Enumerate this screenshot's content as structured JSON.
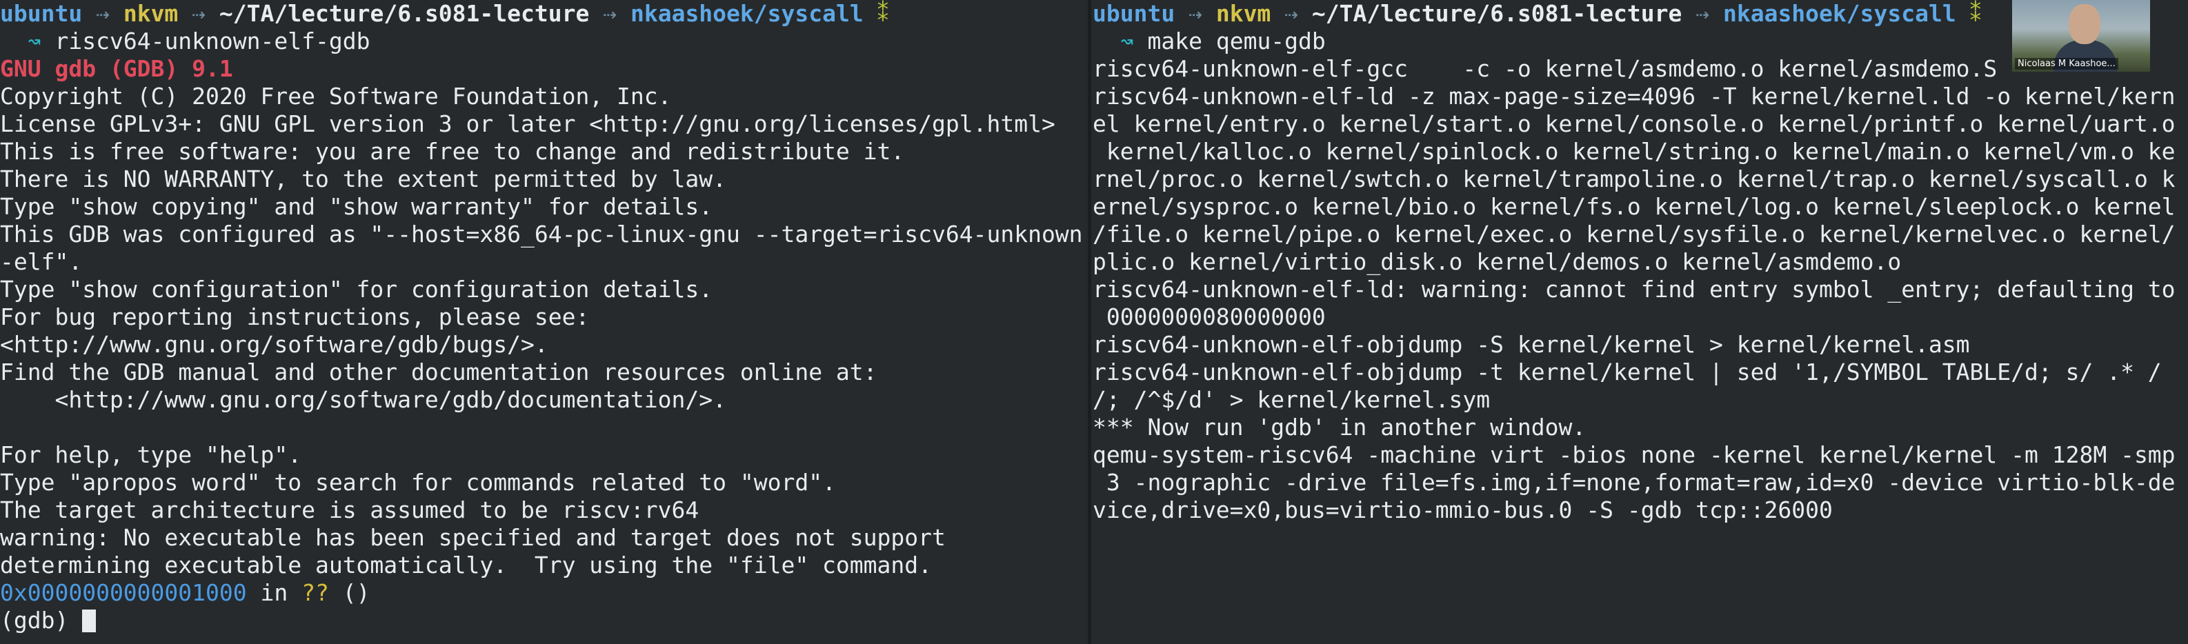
{
  "left_pane": {
    "prompt": {
      "user": "ubuntu",
      "host": "nkvm",
      "path": "~/TA/lecture/6.s081-lecture",
      "branch": "nkaashoek/syscall",
      "git_icon": "⁑",
      "symbol": "↝",
      "command": "riscv64-unknown-elf-gdb"
    },
    "version": "GNU gdb (GDB) 9.1",
    "lines": [
      "Copyright (C) 2020 Free Software Foundation, Inc.",
      "License GPLv3+: GNU GPL version 3 or later <http://gnu.org/licenses/gpl.html>",
      "This is free software: you are free to change and redistribute it.",
      "There is NO WARRANTY, to the extent permitted by law.",
      "Type \"show copying\" and \"show warranty\" for details.",
      "This GDB was configured as \"--host=x86_64-pc-linux-gnu --target=riscv64-unknown",
      "-elf\".",
      "Type \"show configuration\" for configuration details.",
      "For bug reporting instructions, please see:",
      "<http://www.gnu.org/software/gdb/bugs/>.",
      "Find the GDB manual and other documentation resources online at:",
      "    <http://www.gnu.org/software/gdb/documentation/>.",
      "",
      "For help, type \"help\".",
      "Type \"apropos word\" to search for commands related to \"word\".",
      "The target architecture is assumed to be riscv:rv64",
      "warning: No executable has been specified and target does not support",
      "determining executable automatically.  Try using the \"file\" command."
    ],
    "location": {
      "address": "0x0000000000001000",
      "in": "in",
      "func": "??",
      "args": "()"
    },
    "gdb_prompt": "(gdb)"
  },
  "right_pane": {
    "prompt": {
      "user": "ubuntu",
      "host": "nkvm",
      "path": "~/TA/lecture/6.s081-lecture",
      "branch": "nkaashoek/syscall",
      "git_icon": "⁑",
      "symbol": "↝",
      "command": "make qemu-gdb"
    },
    "lines": [
      "riscv64-unknown-elf-gcc    -c -o kernel/asmdemo.o kernel/asmdemo.S",
      "riscv64-unknown-elf-ld -z max-page-size=4096 -T kernel/kernel.ld -o kernel/kern",
      "el kernel/entry.o kernel/start.o kernel/console.o kernel/printf.o kernel/uart.o",
      " kernel/kalloc.o kernel/spinlock.o kernel/string.o kernel/main.o kernel/vm.o ke",
      "rnel/proc.o kernel/swtch.o kernel/trampoline.o kernel/trap.o kernel/syscall.o k",
      "ernel/sysproc.o kernel/bio.o kernel/fs.o kernel/log.o kernel/sleeplock.o kernel",
      "/file.o kernel/pipe.o kernel/exec.o kernel/sysfile.o kernel/kernelvec.o kernel/",
      "plic.o kernel/virtio_disk.o kernel/demos.o kernel/asmdemo.o",
      "riscv64-unknown-elf-ld: warning: cannot find entry symbol _entry; defaulting to",
      " 0000000080000000",
      "riscv64-unknown-elf-objdump -S kernel/kernel > kernel/kernel.asm",
      "riscv64-unknown-elf-objdump -t kernel/kernel | sed '1,/SYMBOL TABLE/d; s/ .* /",
      "/; /^$/d' > kernel/kernel.sym",
      "*** Now run 'gdb' in another window.",
      "qemu-system-riscv64 -machine virt -bios none -kernel kernel/kernel -m 128M -smp",
      " 3 -nographic -drive file=fs.img,if=none,format=raw,id=x0 -device virtio-blk-de",
      "vice,drive=x0,bus=virtio-mmio-bus.0 -S -gdb tcp::26000"
    ]
  },
  "webcam": {
    "name": "Nicolaas M Kaashoe..."
  }
}
